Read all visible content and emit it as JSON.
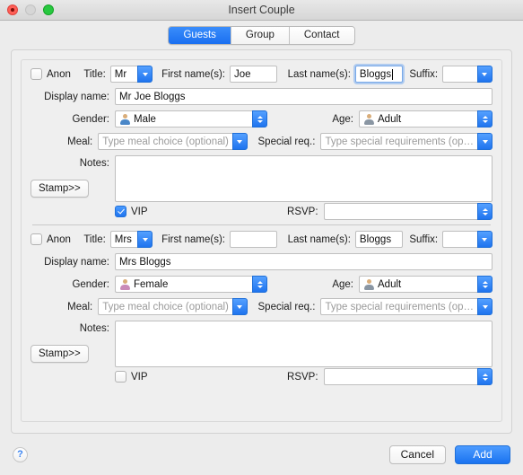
{
  "window": {
    "title": "Insert Couple",
    "traffic_lights": [
      "close-button",
      "minimize-button",
      "maximize-button"
    ]
  },
  "tabs": [
    {
      "label": "Guests",
      "active": true
    },
    {
      "label": "Group",
      "active": false
    },
    {
      "label": "Contact",
      "active": false
    }
  ],
  "labels": {
    "anon": "Anon",
    "title": "Title:",
    "first_names": "First name(s):",
    "last_names": "Last name(s):",
    "suffix": "Suffix:",
    "display_name": "Display name:",
    "gender": "Gender:",
    "age": "Age:",
    "meal": "Meal:",
    "special_req": "Special req.:",
    "notes": "Notes:",
    "vip": "VIP",
    "rsvp": "RSVP:",
    "stamp": "Stamp>>"
  },
  "placeholders": {
    "meal": "Type meal choice (optional)",
    "special_req": "Type special requirements (op…"
  },
  "guests": [
    {
      "anon_checked": false,
      "title": "Mr",
      "first_names": "Joe",
      "last_names": "Bloggs",
      "last_names_focused": true,
      "suffix": "",
      "display_name": "Mr Joe Bloggs",
      "gender": "Male",
      "gender_icon_color": "#4a87c8",
      "age": "Adult",
      "age_icon_color": "#8a96a3",
      "meal": "",
      "special_req": "",
      "notes": "",
      "vip_checked": true,
      "rsvp": ""
    },
    {
      "anon_checked": false,
      "title": "Mrs",
      "first_names": "",
      "last_names": "Bloggs",
      "last_names_focused": false,
      "suffix": "",
      "display_name": "Mrs  Bloggs",
      "gender": "Female",
      "gender_icon_color": "#c98ab8",
      "age": "Adult",
      "age_icon_color": "#8a96a3",
      "meal": "",
      "special_req": "",
      "notes": "",
      "vip_checked": false,
      "rsvp": ""
    }
  ],
  "footer": {
    "help": "?",
    "cancel": "Cancel",
    "add": "Add"
  },
  "colors": {
    "accent_blue": "#1f74ef",
    "window_bg": "#ececec",
    "panel_bg": "#efefef",
    "head_skin": "#d9ad7a"
  }
}
